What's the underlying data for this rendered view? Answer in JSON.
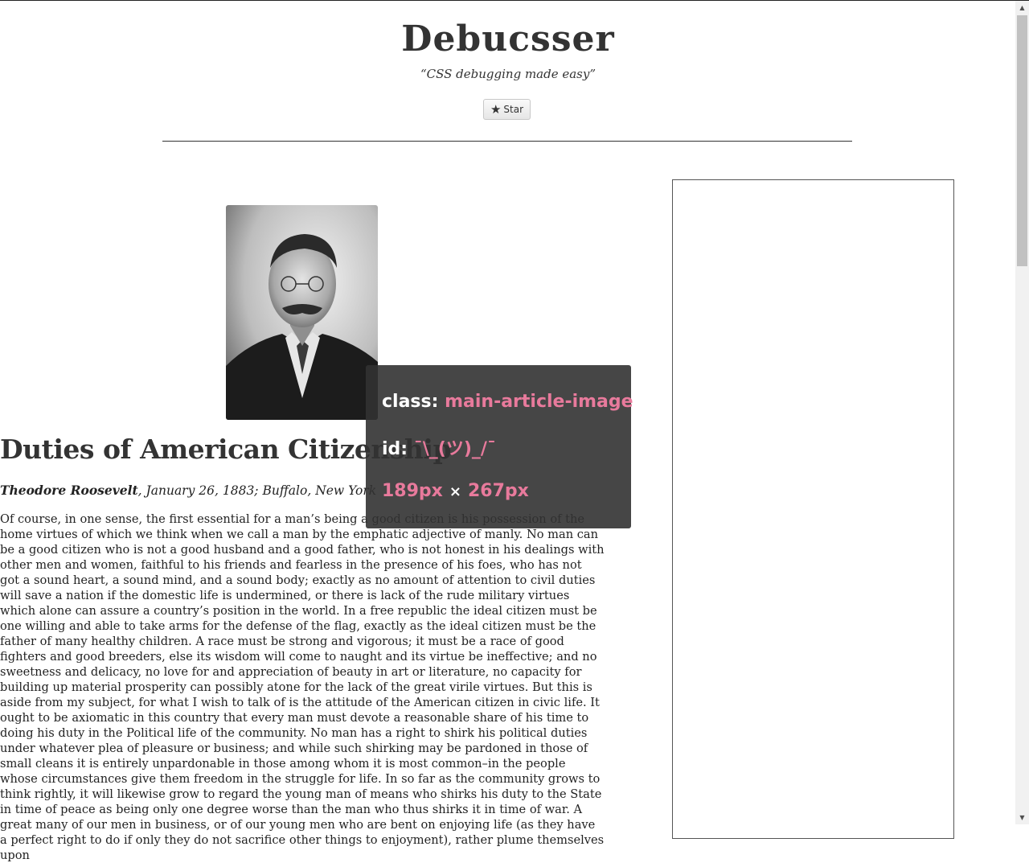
{
  "site": {
    "title": "Debucsser",
    "tagline": "“CSS debugging made easy”",
    "star_label": "Star",
    "star_icon": "star-icon"
  },
  "article": {
    "title": "Duties of American Citizenship",
    "author": "Theodore Roosevelt",
    "dateline": ", January 26, 1883; Buffalo, New York",
    "body": "Of course, in one sense, the first essential for a man’s being a good citizen is his possession of the home virtues of which we think when we call a man by the emphatic adjective of manly. No man can be a good citizen who is not a good husband and a good father, who is not honest in his dealings with other men and women, faithful to his friends and fearless in the presence of his foes, who has not got a sound heart, a sound mind, and a sound body; exactly as no amount of attention to civil duties will save a nation if the domestic life is undermined, or there is lack of the rude military virtues which alone can assure a country’s position in the world. In a free republic the ideal citizen must be one willing and able to take arms for the defense of the flag, exactly as the ideal citizen must be the father of many healthy children. A race must be strong and vigorous; it must be a race of good fighters and good breeders, else its wisdom will come to naught and its virtue be ineffective; and no sweetness and delicacy, no love for and appreciation of beauty in art or literature, no capacity for building up material prosperity can possibly atone for the lack of the great virile virtues. But this is aside from my subject, for what I wish to talk of is the attitude of the American citizen in civic life. It ought to be axiomatic in this country that every man must devote a reasonable share of his time to doing his duty in the Political life of the community. No man has a right to shirk his political duties under whatever plea of pleasure or business; and while such shirking may be pardoned in those of small cleans it is entirely unpardonable in those among whom it is most common–in the people whose circumstances give them freedom in the struggle for life. In so far as the community grows to think rightly, it will likewise grow to regard the young man of means who shirks his duty to the State in time of peace as being only one degree worse than the man who thus shirks it in time of war. A great many of our men in business, or of our young men who are bent on enjoying life (as they have a perfect right to do if only they do not sacrifice other things to enjoyment), rather plume themselves upon"
  },
  "tooltip": {
    "class_label": "class:",
    "class_value": "main-article-image",
    "id_label": "id:",
    "id_value": "¯\\_(ツ)_/¯",
    "width_value": "189px",
    "times": "×",
    "height_value": "267px",
    "accent_color": "#e87a9c"
  }
}
